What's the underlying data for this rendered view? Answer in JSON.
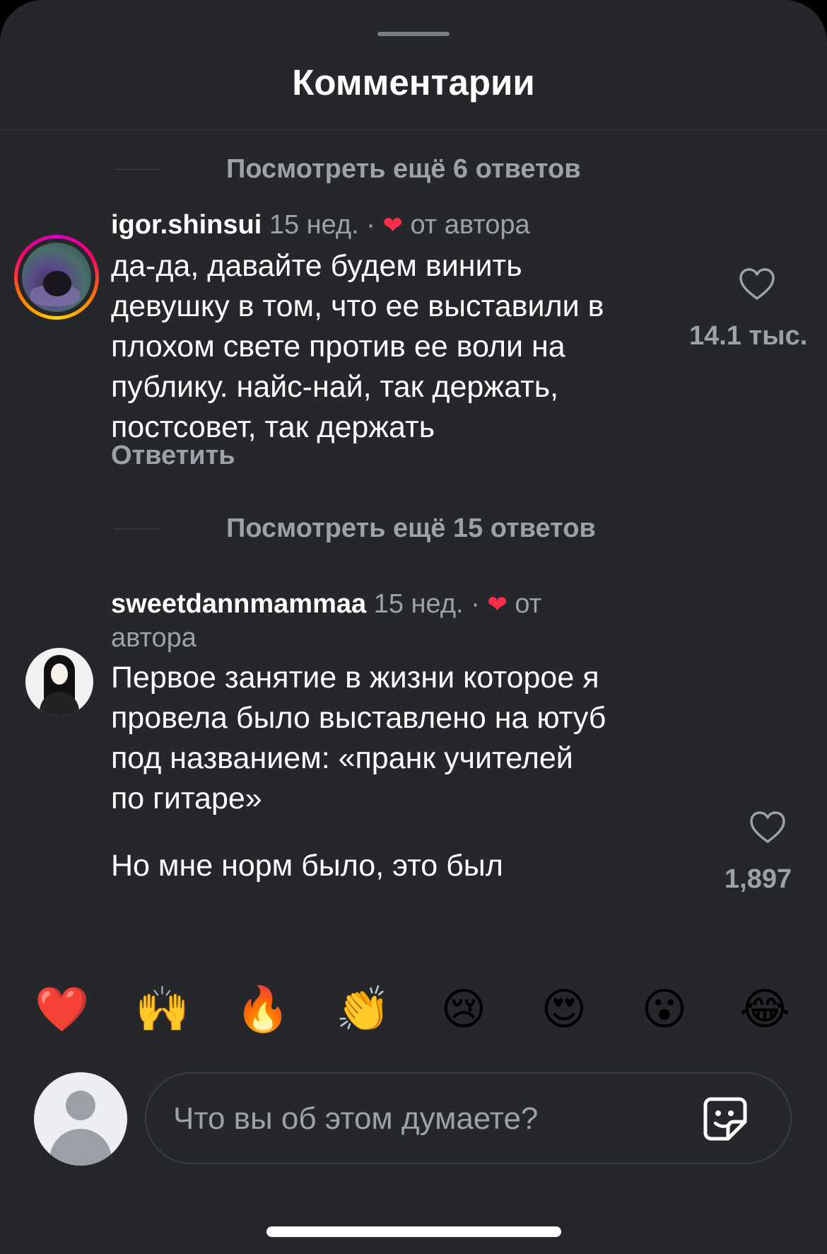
{
  "header": {
    "title": "Комментарии"
  },
  "replies_top": {
    "label": "Посмотреть ещё 6 ответов"
  },
  "comments": [
    {
      "username": "igor.shinsui",
      "time": "15 нед.",
      "separator": "·",
      "author_like": "от автора",
      "text": "да-да, давайте будем винить\nдевушку в том, что ее выставили в\nплохом свете против ее воли на\nпублику. найс-най, так держать,\nпостсовет, так держать",
      "reply_label": "Ответить",
      "likes": "14.1 тыс."
    },
    {
      "username": "sweetdannmammaa",
      "time": "15 нед.",
      "separator": "·",
      "author_like_1": "от",
      "author_like_2": "автора",
      "text": "Первое занятие в жизни которое я\nпровела было выставлено на ютуб\nпод названием: «пранк учителей\nпо гитаре»",
      "text2": "Но мне норм было, это был",
      "likes": "1,897"
    }
  ],
  "replies_mid": {
    "label": "Посмотреть ещё 15 ответов"
  },
  "emojis": [
    "❤️",
    "🙌",
    "🔥",
    "👏",
    "😢",
    "😍",
    "😮",
    "😂"
  ],
  "input": {
    "placeholder": "Что вы об этом думаете?"
  },
  "icons": {
    "heart_outline": "heart-outline-icon",
    "sticker": "sticker-icon",
    "author_heart": "heart-filled-icon"
  },
  "colors": {
    "background": "#25272b",
    "accent_heart": "#ff2d4a",
    "secondary_text": "#9ea2a8"
  }
}
